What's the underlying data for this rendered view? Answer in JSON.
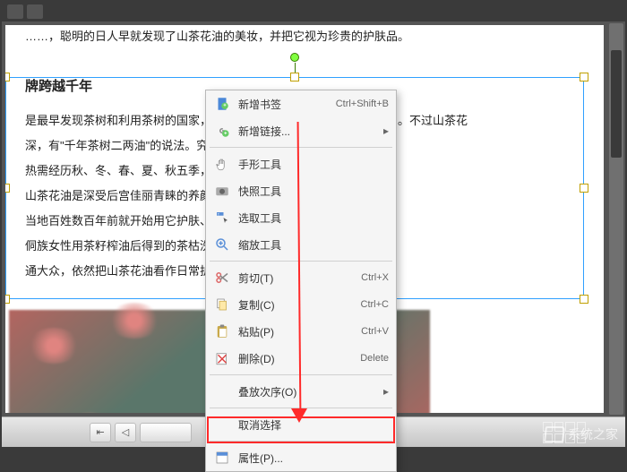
{
  "doc": {
    "line0": "……，聪明的日人早就发现了山茶花油的美妆，并把它视为珍贵的护肤品。",
    "heading": "牌跨越千年",
    "p1": "是最早发现茶树和利用茶树的国家，据传早在原始社会，神农氏……中国。不过山茶花",
    "p2": "深，有\"千年茶树二两油\"的说法。究其原因……年，而山茶果从开",
    "p3": "热需经历秋、冬、春、夏、秋五季，历时……。",
    "p4": "山茶花油是深受后宫佳丽青睐的养颜秘方……美容奇效。在一些",
    "p5": "当地百姓数百年前就开始用它护肤、擦头发……浴，皮肤极富弹性，",
    "p6": "侗族女性用茶籽榨油后得到的茶枯洗发……，从名媛到明星，",
    "p7": "通大众，依然把山茶花油看作日常护肤……"
  },
  "menu": {
    "add_bookmark": "新增书签",
    "add_bookmark_key": "Ctrl+Shift+B",
    "add_link": "新增链接...",
    "hand_tool": "手形工具",
    "snapshot_tool": "快照工具",
    "select_tool": "选取工具",
    "zoom_tool": "缩放工具",
    "cut": "剪切(T)",
    "cut_key": "Ctrl+X",
    "copy": "复制(C)",
    "copy_key": "Ctrl+C",
    "paste": "粘贴(P)",
    "paste_key": "Ctrl+V",
    "delete": "删除(D)",
    "delete_key": "Delete",
    "stacking": "叠放次序(O)",
    "deselect": "取消选择",
    "properties": "属性(P)..."
  },
  "watermark": "系统之家"
}
